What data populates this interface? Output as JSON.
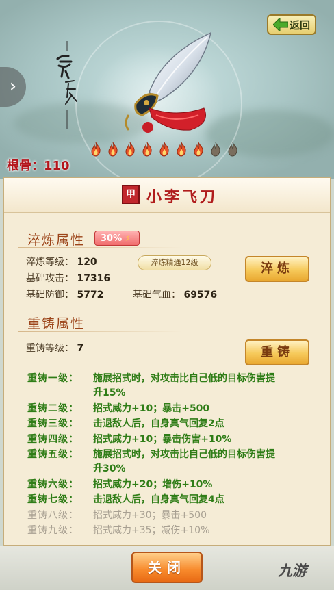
{
  "header": {
    "back_label": "返回",
    "calligraphy_text": "奇属"
  },
  "root": {
    "label": "根骨：",
    "value": "110"
  },
  "flames": {
    "lit": 7,
    "total": 9,
    "lit_color": "#e8542a",
    "unlit_color": "#7a6e5e"
  },
  "item": {
    "grade_badge": "甲",
    "name": "小李飞刀"
  },
  "refine": {
    "title": "淬炼属性",
    "percent": "30%",
    "mastery": "淬炼精通12级",
    "button": "淬炼",
    "stats": [
      {
        "label": "淬炼等级：",
        "value": "120"
      },
      {
        "label": "基础攻击：",
        "value": "17316"
      },
      {
        "label": "基础防御：",
        "value": "5772"
      },
      {
        "label": "基础气血：",
        "value": "69576"
      }
    ]
  },
  "recast": {
    "title": "重铸属性",
    "level_label": "重铸等级：",
    "level_value": "7",
    "button": "重铸",
    "effects": [
      {
        "level": "重铸一级：",
        "text": "施展招式时，对攻击比自己低的目标伤害提",
        "text2": "升15%",
        "active": true
      },
      {
        "level": "重铸二级：",
        "text": "招式威力+10；暴击+500",
        "active": true
      },
      {
        "level": "重铸三级：",
        "text": "击退敌人后，自身真气回复2点",
        "active": true
      },
      {
        "level": "重铸四级：",
        "text": "招式威力+10；暴击伤害+10%",
        "active": true
      },
      {
        "level": "重铸五级：",
        "text": "施展招式时，对攻击比自己低的目标伤害提",
        "text2": "升30%",
        "active": true
      },
      {
        "level": "重铸六级：",
        "text": "招式威力+20；增伤+10%",
        "active": true
      },
      {
        "level": "重铸七级：",
        "text": "击退敌人后，自身真气回复4点",
        "active": true
      },
      {
        "level": "重铸八级：",
        "text": "招式威力+30；暴击+500",
        "active": false
      },
      {
        "level": "重铸九级：",
        "text": "招式威力+35；减伤+10%",
        "active": false
      }
    ]
  },
  "footer": {
    "close_label": "关闭",
    "watermark": "九游"
  }
}
